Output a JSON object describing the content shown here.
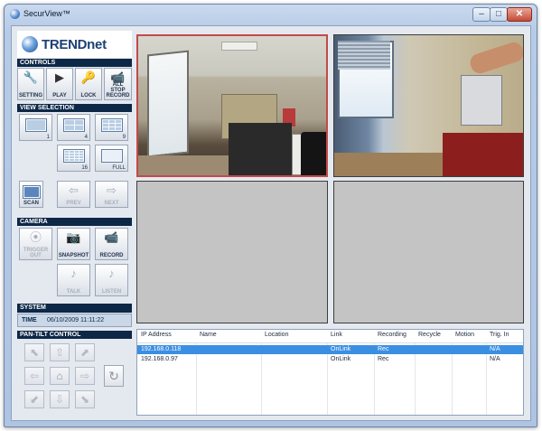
{
  "window": {
    "title": "SecurView™"
  },
  "brand": {
    "logo": "TRENDnet"
  },
  "controls": {
    "header": "CONTROLS",
    "buttons": [
      {
        "label": "SETTING",
        "icon": "wrench-icon"
      },
      {
        "label": "PLAY",
        "icon": "play-icon"
      },
      {
        "label": "LOCK",
        "icon": "lock-icon"
      },
      {
        "label": "ALL STOP RECORD",
        "icon": "camera-stop-icon"
      }
    ]
  },
  "view_selection": {
    "header": "VIEW SELECTION",
    "buttons": [
      {
        "label": "1"
      },
      {
        "label": "4"
      },
      {
        "label": "9"
      },
      {
        "label": "16"
      },
      {
        "label": "FULL"
      },
      {
        "label": "SCAN"
      },
      {
        "label": "PREV"
      },
      {
        "label": "NEXT"
      }
    ]
  },
  "camera": {
    "header": "CAMERA",
    "buttons": [
      {
        "label": "TRIGGER OUT"
      },
      {
        "label": "SNAPSHOT"
      },
      {
        "label": "RECORD"
      },
      {
        "label": "TALK"
      },
      {
        "label": "LISTEN"
      }
    ]
  },
  "system": {
    "header": "SYSTEM",
    "time_label": "TIME",
    "time_value": "06/10/2009 11:11:22"
  },
  "pan_tilt": {
    "header": "PAN-TILT CONTROL"
  },
  "device_table": {
    "columns": [
      "IP Address",
      "Name",
      "Location",
      "Link",
      "Recording",
      "Recycle",
      "Motion",
      "Trig. In"
    ],
    "rows": [
      {
        "ip": "192.168.0.118",
        "name": "",
        "location": "",
        "link": "OnLink",
        "recording": "Rec",
        "recycle": "",
        "motion": "",
        "trig_in": "N/A",
        "selected": true
      },
      {
        "ip": "192.168.0.97",
        "name": "",
        "location": "",
        "link": "OnLink",
        "recording": "Rec",
        "recycle": "",
        "motion": "",
        "trig_in": "N/A",
        "selected": false
      }
    ]
  },
  "colors": {
    "header_bg": "#0d2847",
    "selection": "#3b8fe2",
    "active_camera_border": "#c24a4a"
  }
}
